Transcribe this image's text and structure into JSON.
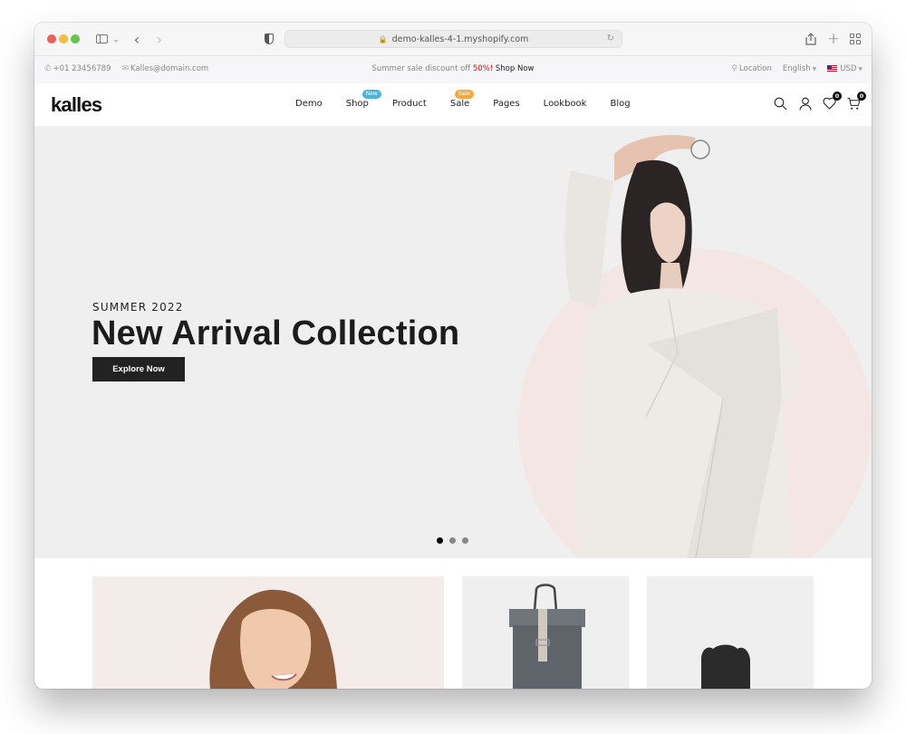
{
  "browser": {
    "url": "demo-kalles-4-1.myshopify.com",
    "icons": [
      "sidebar-toggle-icon",
      "chevron-down-icon",
      "back-icon",
      "forward-icon",
      "privacy-shield-icon",
      "lock-icon",
      "reload-icon",
      "share-icon",
      "new-tab-icon",
      "tab-overview-icon"
    ]
  },
  "topbar": {
    "phone": "+01 23456789",
    "email": "Kalles@domain.com",
    "promo_prefix": "Summer sale discount off ",
    "promo_percent": "50%!",
    "promo_link": "Shop Now",
    "location": "Location",
    "language": "English",
    "currency": "USD",
    "accent_color": "#ec0101"
  },
  "header": {
    "logo": "kalles",
    "nav": [
      {
        "label": "Demo"
      },
      {
        "label": "Shop",
        "badge": "New",
        "badge_color": "#4bb4d9"
      },
      {
        "label": "Product"
      },
      {
        "label": "Sale",
        "badge": "Sale",
        "badge_color": "#f6a93b"
      },
      {
        "label": "Pages"
      },
      {
        "label": "Lookbook"
      },
      {
        "label": "Blog"
      }
    ],
    "wishlist_count": "0",
    "cart_count": "0"
  },
  "hero": {
    "subtitle": "SUMMER 2022",
    "title": "New Arrival Collection",
    "cta": "Explore Now",
    "slides_total": 3,
    "active_slide": 1
  },
  "products": {
    "cards": [
      {
        "name": "woman-portrait-banner"
      },
      {
        "name": "grey-backpack"
      },
      {
        "name": "black-bag"
      }
    ]
  }
}
